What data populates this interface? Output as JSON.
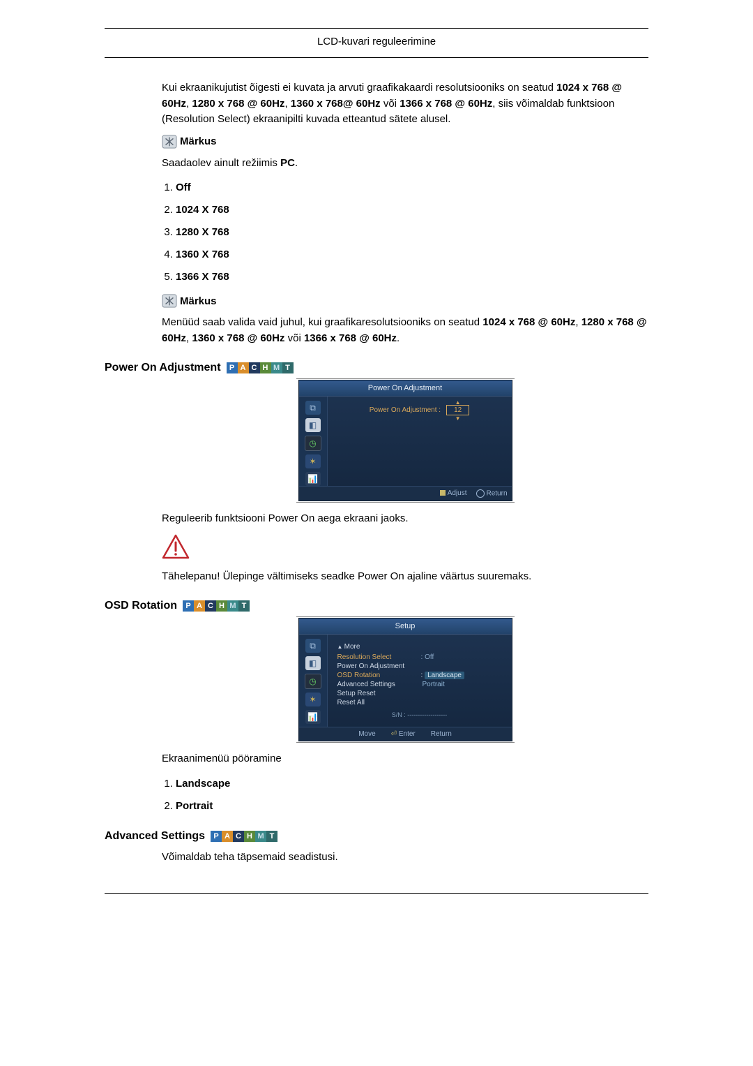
{
  "header": {
    "title": "LCD-kuvari reguleerimine"
  },
  "intro": {
    "pre": "Kui ekraanikujutist õigesti ei kuvata ja arvuti graafikakaardi resolutsiooniks on seatud ",
    "r1": "1024 x 768 @ 60Hz",
    "sep": ", ",
    "r2": "1280 x 768 @ 60Hz",
    "r3": "1360 x 768@ 60Hz",
    "or": " või ",
    "r4": "1366 x 768 @ 60Hz",
    "post": ", siis võimaldab funktsioon (Resolution Select) ekraanipilti kuvada etteantud sätete alusel."
  },
  "note_label": "Märkus",
  "note1_text_a": "Saadaolev ainult režiimis ",
  "note1_text_b": "PC",
  "note1_text_c": ".",
  "res_options": [
    "Off",
    "1024 X 768",
    "1280 X 768",
    "1360 X 768",
    "1366 X 768"
  ],
  "note2": {
    "pre": "Menüüd saab valida vaid juhul, kui graafikaresolutsiooniks on seatud ",
    "r1": "1024 x 768 @ 60Hz",
    "sep": ", ",
    "r2": "1280 x 768 @ 60Hz",
    "r3": "1360 x 768 @ 60Hz",
    "or": " või ",
    "r4": "1366 x 768 @ 60Hz",
    "post": "."
  },
  "modes": [
    "P",
    "A",
    "C",
    "H",
    "M",
    "T"
  ],
  "poa": {
    "heading": "Power On Adjustment",
    "osd_title": "Power On Adjustment",
    "osd_label": "Power On Adjustment :",
    "osd_value": "12",
    "foot_adjust": "Adjust",
    "foot_return": "Return",
    "desc": "Reguleerib funktsiooni Power On aega ekraani jaoks.",
    "warn": "Tähelepanu! Ülepinge vältimiseks seadke Power On ajaline väärtus suuremaks."
  },
  "osdr": {
    "heading": "OSD Rotation",
    "osd_title": "Setup",
    "more": "More",
    "rows": {
      "resolution_select": {
        "label": "Resolution Select",
        "value": "Off"
      },
      "power_on_adj": {
        "label": "Power On Adjustment"
      },
      "osd_rotation": {
        "label": "OSD Rotation",
        "value": "Landscape"
      },
      "advanced": {
        "label": "Advanced Settings",
        "value": "Portrait"
      },
      "setup_reset": {
        "label": "Setup Reset"
      },
      "reset_all": {
        "label": "Reset All"
      }
    },
    "sn": "S/N : -------------------",
    "foot_move": "Move",
    "foot_enter": "Enter",
    "foot_return": "Return",
    "desc": "Ekraanimenüü pööramine",
    "options": [
      "Landscape",
      "Portrait"
    ]
  },
  "adv": {
    "heading": "Advanced Settings",
    "desc": "Võimaldab teha täpsemaid seadistusi."
  }
}
